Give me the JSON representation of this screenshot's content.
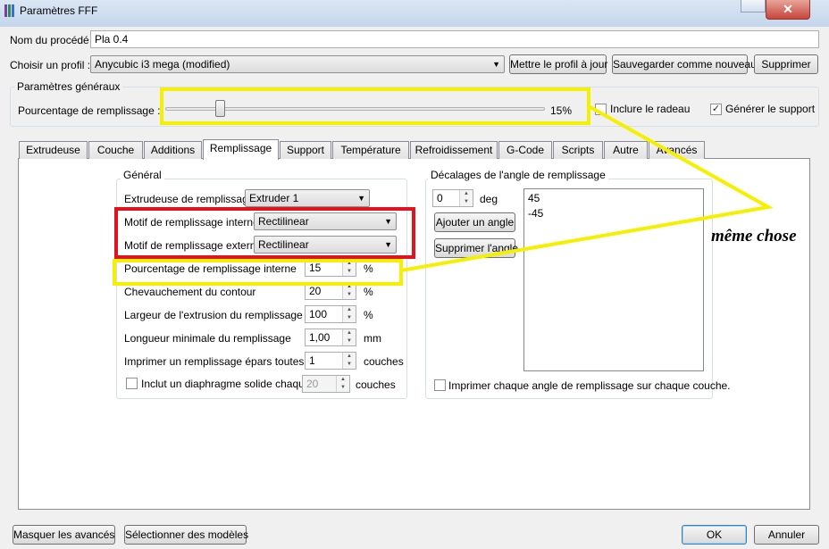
{
  "window": {
    "title": "Paramètres FFF",
    "close_glyph": "✕"
  },
  "process": {
    "label": "Nom du procédé :",
    "value": "Pla 0.4"
  },
  "profile": {
    "label": "Choisir un profil :",
    "selected": "Anycubic i3 mega (modified)",
    "update_button": "Mettre le profil à jour",
    "save_new_button": "Sauvegarder comme nouveau",
    "delete_button": "Supprimer"
  },
  "general": {
    "title": "Paramètres généraux",
    "infill_label": "Pourcentage de remplissage :",
    "infill_value": "15%",
    "infill_percent": 15,
    "raft_label": "Inclure le radeau",
    "raft_checked": false,
    "support_label": "Générer le support",
    "support_checked": true
  },
  "tabs": [
    "Extrudeuse",
    "Couche",
    "Additions",
    "Remplissage",
    "Support",
    "Température",
    "Refroidissement",
    "G-Code",
    "Scripts",
    "Autre",
    "Avancés"
  ],
  "active_tab": "Remplissage",
  "infill": {
    "group_title": "Général",
    "extruder_label": "Extrudeuse de remplissage",
    "extruder_value": "Extruder 1",
    "internal_pattern_label": "Motif de remplissage interne",
    "internal_pattern_value": "Rectilinear",
    "external_pattern_label": "Motif de remplissage externe",
    "external_pattern_value": "Rectilinear",
    "internal_percent_label": "Pourcentage de remplissage interne",
    "internal_percent_value": "15",
    "internal_percent_unit": "%",
    "overlap_label": "Chevauchement du contour",
    "overlap_value": "20",
    "overlap_unit": "%",
    "width_label": "Largeur de l'extrusion du remplissage",
    "width_value": "100",
    "width_unit": "%",
    "min_length_label": "Longueur minimale du remplissage",
    "min_length_value": "1,00",
    "min_length_unit": "mm",
    "sparse_label": "Imprimer un remplissage épars toutes les",
    "sparse_value": "1",
    "sparse_unit": "couches",
    "diaphragm_label": "Inclut un diaphragme solide chaque",
    "diaphragm_checked": false,
    "diaphragm_value": "20",
    "diaphragm_unit": "couches"
  },
  "angles": {
    "group_title": "Décalages de l'angle de remplissage",
    "input_value": "0",
    "unit": "deg",
    "add_button": "Ajouter un angle",
    "remove_button": "Supprimer l'angle",
    "list": [
      "45",
      "-45"
    ],
    "each_layer_label": "Imprimer chaque angle de remplissage sur chaque couche.",
    "each_layer_checked": false
  },
  "footer": {
    "hide_advanced": "Masquer les avancés",
    "select_models": "Sélectionner des modèles",
    "ok": "OK",
    "cancel": "Annuler"
  },
  "annotation": {
    "text": "même chose",
    "yellow_color": "#f5f000",
    "red_color": "#e0141e"
  }
}
